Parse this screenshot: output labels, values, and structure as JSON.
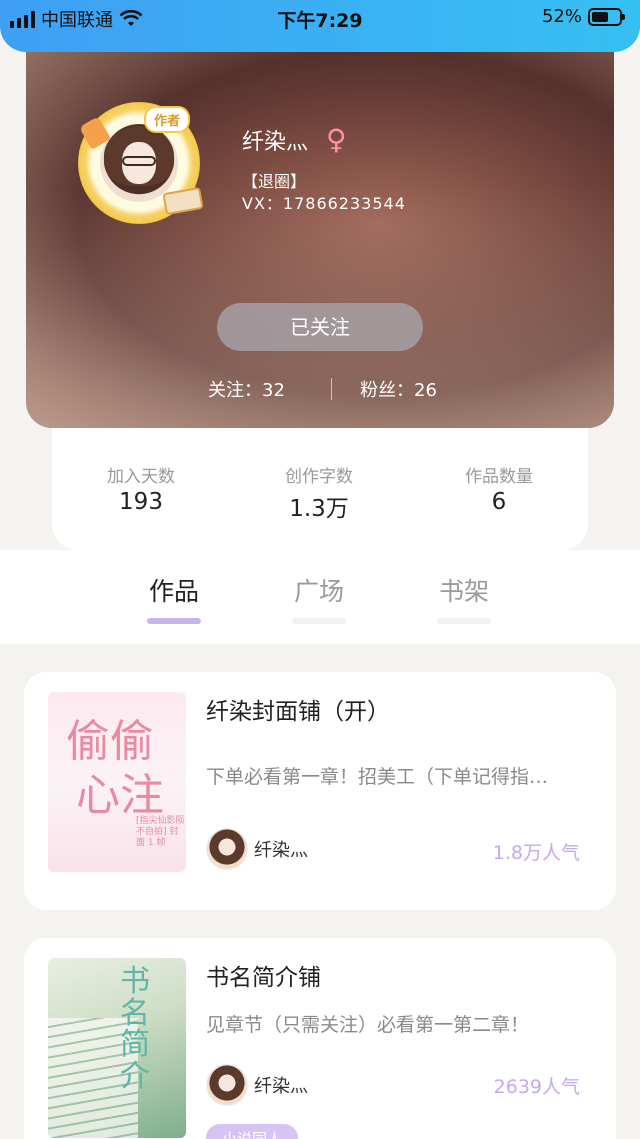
{
  "status_bar": {
    "carrier": "中国联通",
    "time": "下午7:29",
    "battery": "52%"
  },
  "profile": {
    "author_tag": "作者",
    "name": "纤染灬",
    "gender_symbol": "♀",
    "bio_line1": "【退圈】",
    "bio_line2": "VX：17866233544",
    "follow_button": "已关注",
    "following": "关注：32",
    "fans": "粉丝：26"
  },
  "stats": [
    {
      "label": "加入天数",
      "value": "193"
    },
    {
      "label": "创作字数",
      "value": "1.3万"
    },
    {
      "label": "作品数量",
      "value": "6"
    }
  ],
  "tabs": [
    {
      "label": "作品",
      "active": true
    },
    {
      "label": "广场",
      "active": false
    },
    {
      "label": "书架",
      "active": false
    }
  ],
  "works": [
    {
      "title": "纤染封面铺（开）",
      "description": "下单必看第一章！招美工（下单记得指…",
      "author": "纤染灬",
      "popularity": "1.8万人气",
      "cover_text": [
        "偷偷",
        "心注",
        "[指尖仙影陨 不自拍] 封面 1 帧"
      ]
    },
    {
      "title": "书名简介铺",
      "description": "见章节（只需关注）必看第一第二章！",
      "author": "纤染灬",
      "popularity": "2639人气",
      "cover_text": "书名简介",
      "tag": "小说同人"
    }
  ],
  "colors": {
    "status_bar": "#3f9ff5",
    "accent_purple": "#c9b3ec",
    "popularity": "#c6a9e8",
    "gender": "#ff8fa6"
  }
}
